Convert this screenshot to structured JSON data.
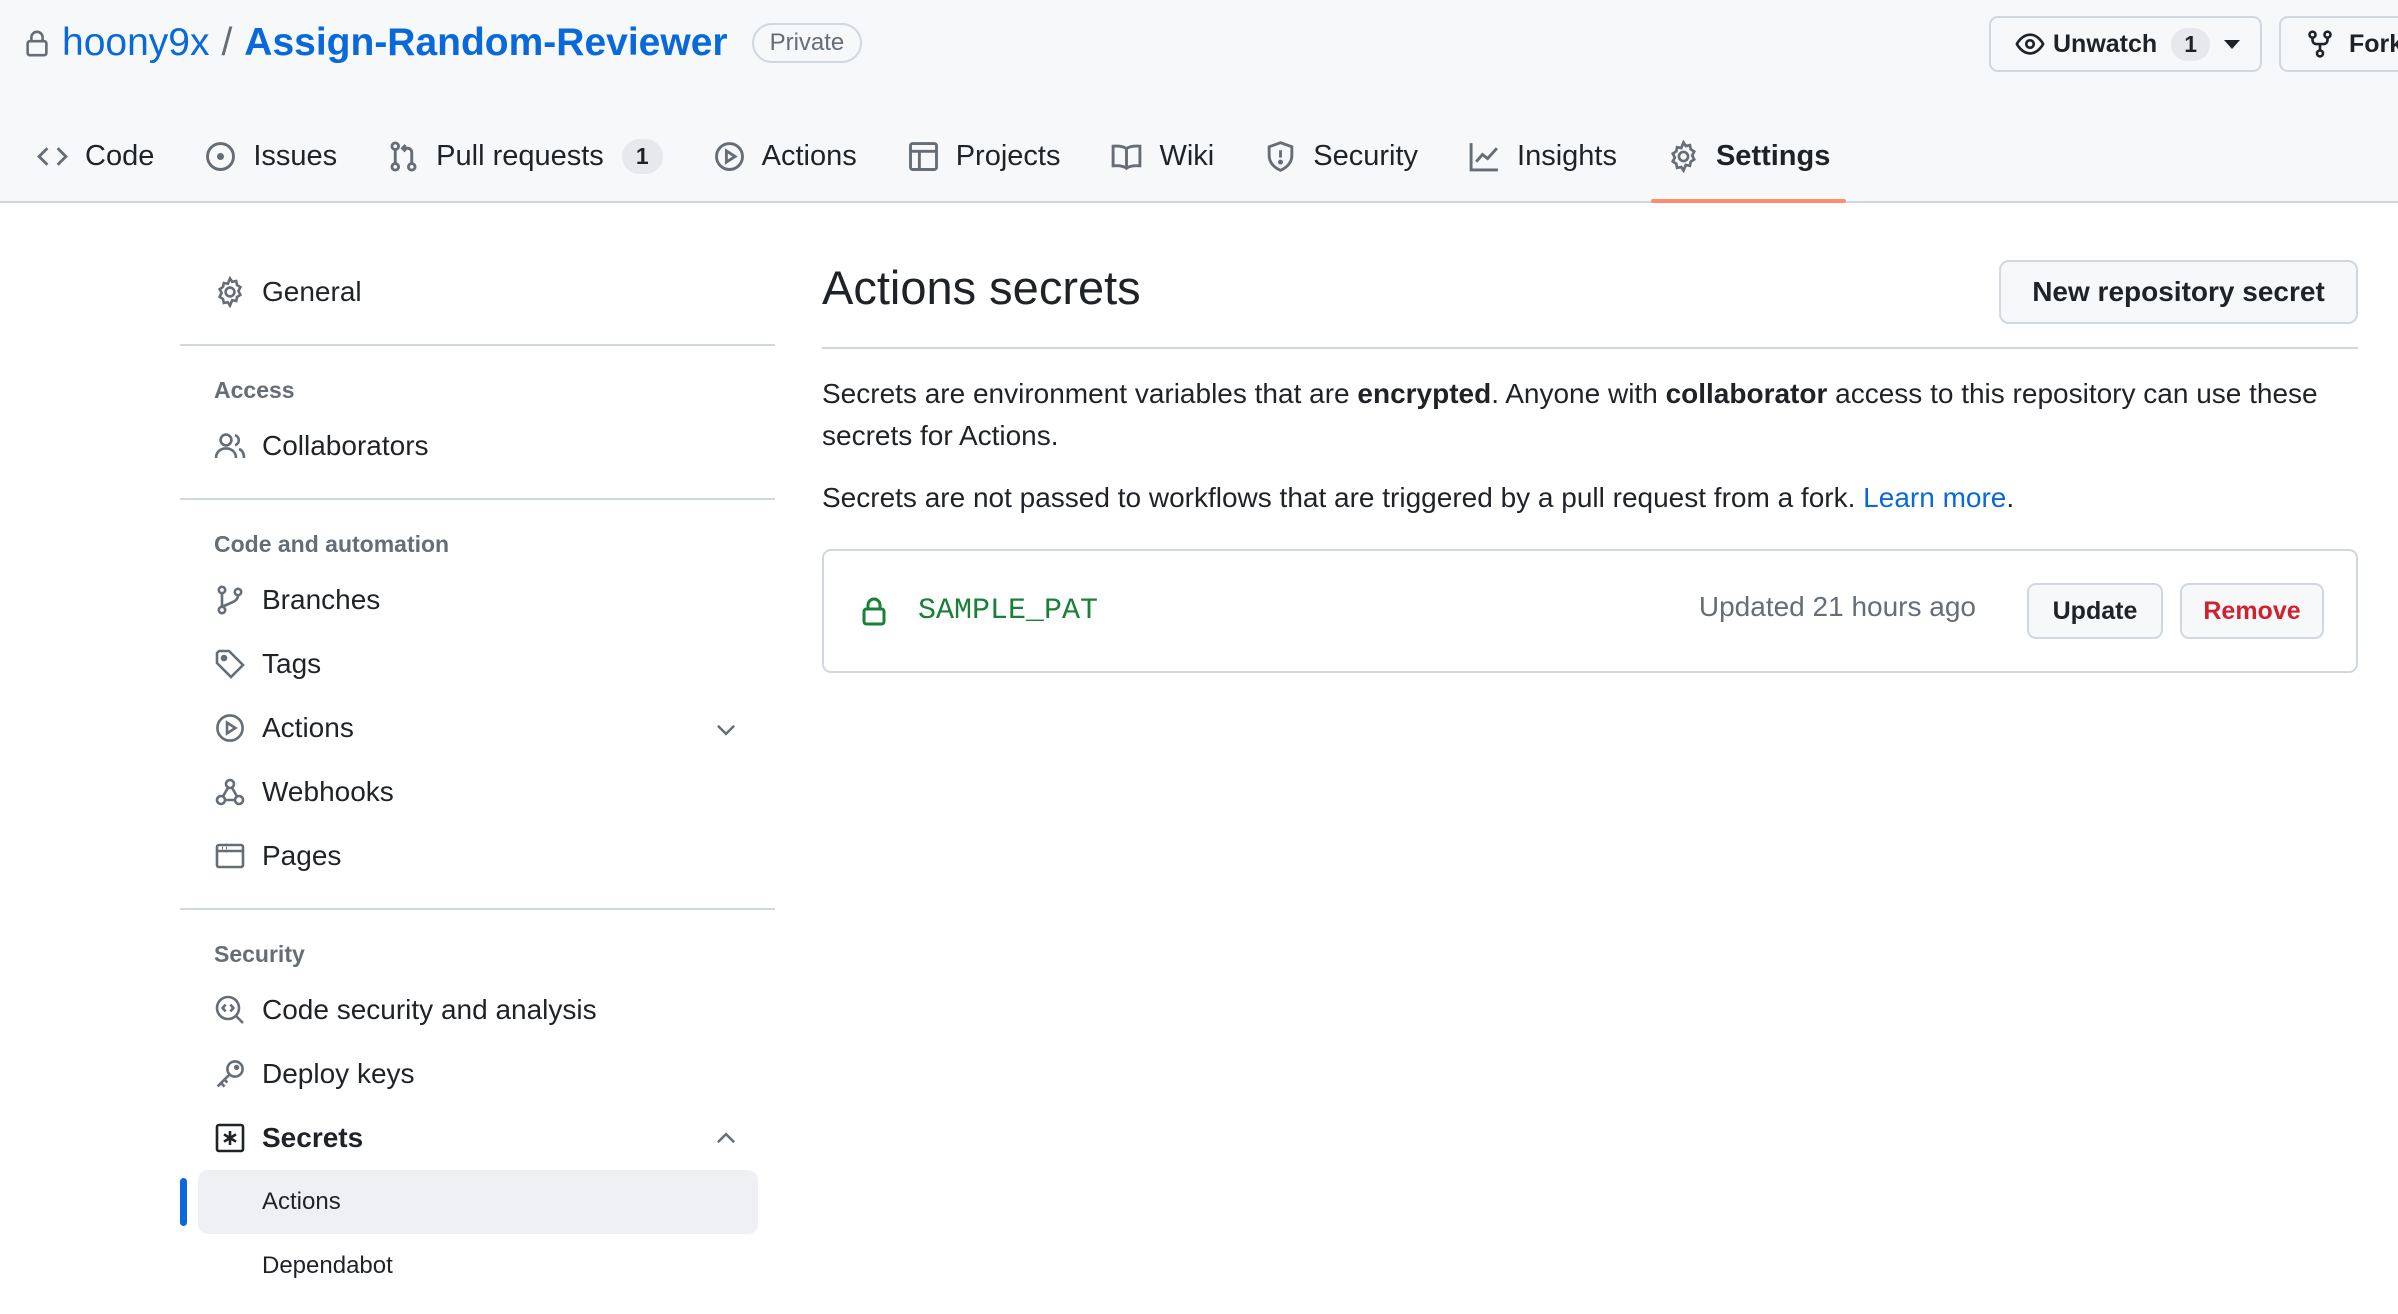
{
  "repo": {
    "owner": "hoony9x",
    "separator": "/",
    "name": "Assign-Random-Reviewer",
    "visibility": "Private"
  },
  "watch": {
    "label": "Unwatch",
    "count": "1"
  },
  "fork": {
    "label": "Fork"
  },
  "tabs": [
    {
      "label": "Code",
      "icon": "code-icon"
    },
    {
      "label": "Issues",
      "icon": "issue-icon"
    },
    {
      "label": "Pull requests",
      "icon": "pull-request-icon",
      "count": "1"
    },
    {
      "label": "Actions",
      "icon": "play-icon"
    },
    {
      "label": "Projects",
      "icon": "table-icon"
    },
    {
      "label": "Wiki",
      "icon": "book-icon"
    },
    {
      "label": "Security",
      "icon": "shield-icon"
    },
    {
      "label": "Insights",
      "icon": "graph-icon"
    },
    {
      "label": "Settings",
      "icon": "gear-icon",
      "selected": true
    }
  ],
  "sidebar": {
    "general": "General",
    "access_heading": "Access",
    "collaborators": "Collaborators",
    "code_heading": "Code and automation",
    "branches": "Branches",
    "tags": "Tags",
    "actions": "Actions",
    "webhooks": "Webhooks",
    "pages": "Pages",
    "security_heading": "Security",
    "code_security": "Code security and analysis",
    "deploy_keys": "Deploy keys",
    "secrets": "Secrets",
    "secrets_actions": "Actions",
    "secrets_dependabot": "Dependabot"
  },
  "main": {
    "title": "Actions secrets",
    "new_secret_button": "New repository secret",
    "desc1_a": "Secrets are environment variables that are ",
    "desc1_b": "encrypted",
    "desc1_c": ". Anyone with ",
    "desc1_d": "collaborator",
    "desc1_e": " access to this repository can use these secrets for Actions.",
    "desc2_a": "Secrets are not passed to workflows that are triggered by a pull request from a fork. ",
    "desc2_link": "Learn more",
    "desc2_end": "."
  },
  "secrets": [
    {
      "name": "SAMPLE_PAT",
      "updated": "Updated 21 hours ago",
      "update_label": "Update",
      "remove_label": "Remove"
    }
  ],
  "colors": {
    "link": "#0969da",
    "tab_underline": "#fd8c73",
    "secret_name": "#1a7f37",
    "danger": "#cf222e"
  }
}
